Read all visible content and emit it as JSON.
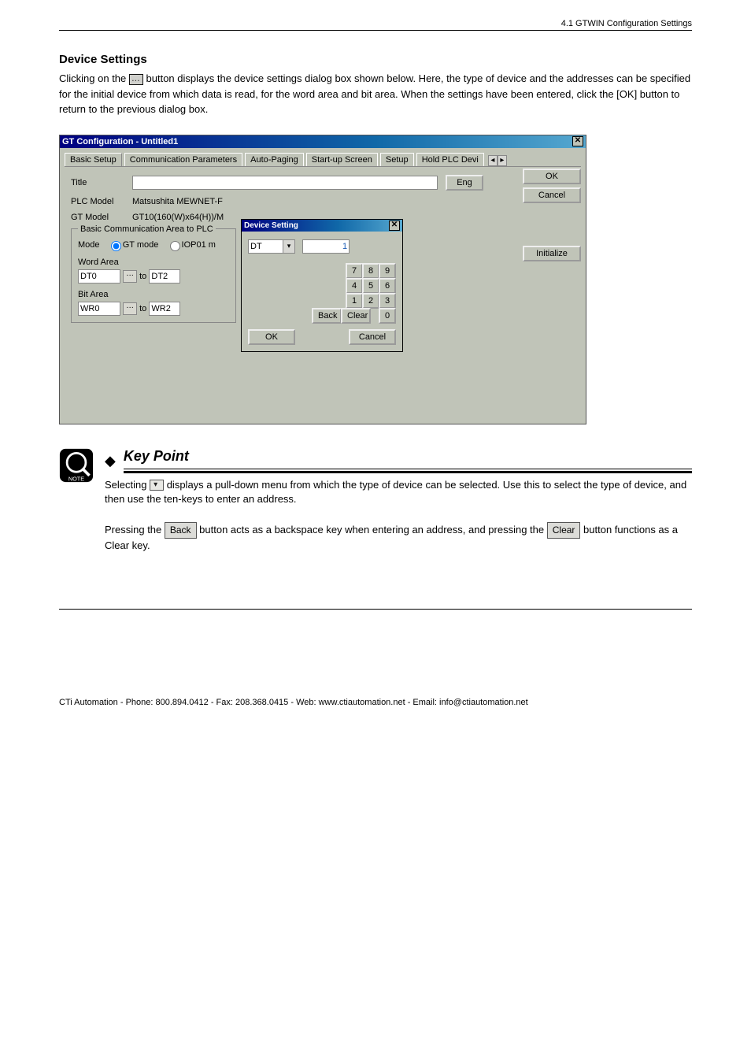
{
  "header": {
    "left": "",
    "right": "4.1  GTWIN Configuration Settings"
  },
  "sections": {
    "devset_title": "Device Settings",
    "devset_body_pre": "Clicking on the ",
    "devset_body_post": " button displays the device settings dialog box shown below. Here, the type of device and the addresses can be specified for the initial device from which data is read, for the word area and bit area. When the settings have been entered, click the [OK] button to return to the previous dialog box."
  },
  "window": {
    "title": "GT Configuration - Untitled1",
    "tabs": [
      "Basic Setup",
      "Communication Parameters",
      "Auto-Paging",
      "Start-up Screen",
      "Setup",
      "Hold PLC Devi"
    ],
    "btn_ok": "OK",
    "btn_cancel": "Cancel",
    "btn_init": "Initialize",
    "form": {
      "lbl_title": "Title",
      "btn_eng": "Eng",
      "lbl_plc": "PLC Model",
      "plc_val": "Matsushita MEWNET-F",
      "lbl_gt": "GT Model",
      "gt_val": "GT10(160(W)x64(H))/M",
      "fieldset_legend": "Basic Communication Area to PLC",
      "mode_lbl": "Mode",
      "mode_opts": [
        "GT mode",
        "IOP01 m"
      ],
      "word_lbl": "Word Area",
      "word_from": "DT0",
      "word_to_lbl": "to",
      "word_to": "DT2",
      "bit_lbl": "Bit Area",
      "bit_from": "WR0",
      "bit_to_lbl": "to",
      "bit_to": "WR2"
    }
  },
  "popup": {
    "title": "Device Setting",
    "select_val": "DT",
    "num_val": "1",
    "keypad_rows": [
      [
        "7",
        "8",
        "9"
      ],
      [
        "4",
        "5",
        "6"
      ],
      [
        "1",
        "2",
        "3"
      ]
    ],
    "key_zero": "0",
    "btn_back": "Back",
    "btn_clear": "Clear",
    "btn_ok": "OK",
    "btn_cancel": "Cancel"
  },
  "kp": {
    "title": "Key Point",
    "para1_pre": "Selecting ",
    "para1_post": " displays a pull-down menu from which the type of device can be selected. Use this to select the type of device, and then use the ten-keys to enter an address.",
    "para2_pre": "Pressing the ",
    "para2_mid": " button acts as a backspace key when entering an address, and pressing the ",
    "para2_post": " button functions as a Clear key.",
    "btn_back": "Back",
    "btn_clear": "Clear"
  },
  "footer": {
    "manual": "CTi Automation - Phone: 800.894.0412 - Fax: 208.368.0415 - Web: www.ctiautomation.net - Email: info@ctiautomation.net",
    "page": ""
  }
}
